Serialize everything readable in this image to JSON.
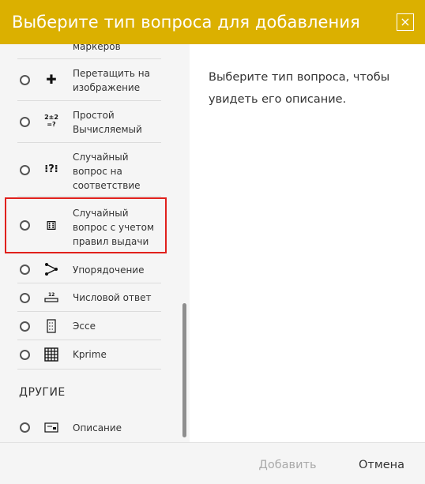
{
  "dialog": {
    "title": "Выберите тип вопроса для добавления",
    "close_label": "×"
  },
  "left_pane": {
    "items": [
      {
        "label": "маркеров"
      },
      {
        "label": "Перетащить на изображение",
        "icon": "move-cross-icon"
      },
      {
        "label": "Простой Вычисляемый",
        "icon": "calculated-icon"
      },
      {
        "label": "Случайный вопрос на соответствие",
        "icon": "random-match-icon"
      },
      {
        "label": "Случайный вопрос с учетом правил выдачи",
        "icon": "dice-icon"
      },
      {
        "label": "Упорядочение",
        "icon": "ordering-icon"
      },
      {
        "label": "Числовой ответ",
        "icon": "numerical-icon"
      },
      {
        "label": "Эссе",
        "icon": "essay-icon"
      },
      {
        "label": "Kprime",
        "icon": "grid-icon"
      }
    ],
    "section_other": "ДРУГИЕ",
    "other_items": [
      {
        "label": "Описание",
        "icon": "description-icon"
      }
    ]
  },
  "right_pane": {
    "description": "Выберите тип вопроса, чтобы увидеть его описание."
  },
  "footer": {
    "add_label": "Добавить",
    "cancel_label": "Отмена"
  },
  "colors": {
    "header_bg": "#dbb000",
    "highlight": "#e0201c"
  }
}
